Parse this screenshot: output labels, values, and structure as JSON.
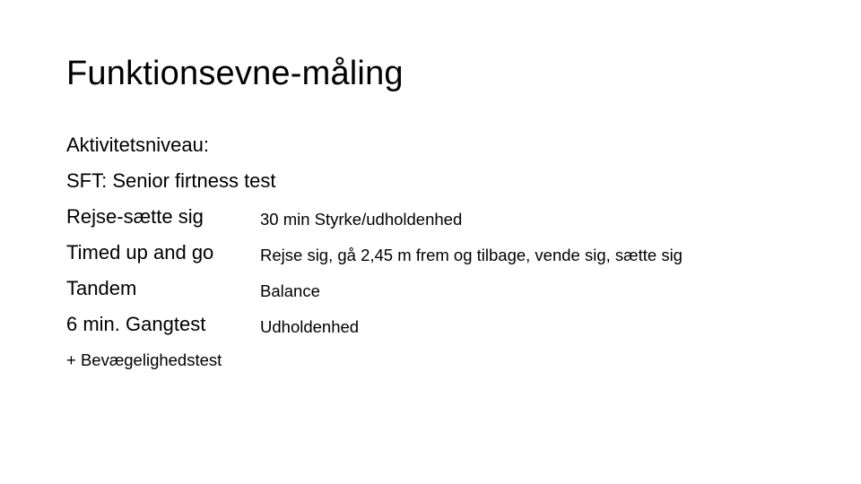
{
  "slide": {
    "title": "Funktionsevne-måling",
    "intro_lines": [
      "Aktivitetsniveau:",
      "SFT: Senior firtness test"
    ],
    "tests": [
      {
        "name": "Rejse-sætte sig",
        "description": "30 min Styrke/udholdenhed"
      },
      {
        "name": "Timed up and go",
        "description": "Rejse sig, gå 2,45 m frem og tilbage, vende sig, sætte sig"
      },
      {
        "name": "Tandem",
        "description": "Balance"
      },
      {
        "name": "6 min. Gangtest",
        "description": "Udholdenhed"
      }
    ],
    "footer_line": "+ Bevægelighedstest"
  }
}
